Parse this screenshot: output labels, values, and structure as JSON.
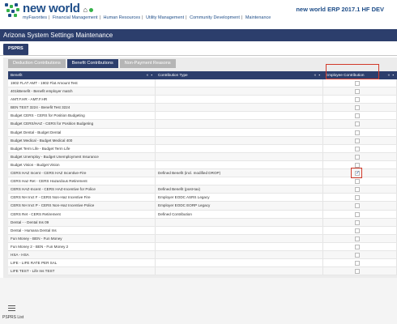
{
  "brand": {
    "name": "new world",
    "env": "new world ERP 2017.1 HF DEV"
  },
  "nav": [
    "myFavorites",
    "Financial Management",
    "Human Resources",
    "Utility Management",
    "Community Development",
    "Maintenance"
  ],
  "page_title": "Arizona System Settings Maintenance",
  "top_tab": "PSPRS",
  "subtabs": [
    "Deduction Contributions",
    "Benefit Contributions",
    "Non-Payment Reasons"
  ],
  "active_subtab": "Benefit Contributions",
  "grid": {
    "headers": [
      "Benefit",
      "Contribution Type",
      "Employee Contribution"
    ],
    "rows": [
      {
        "benefit": "1902 FLAT AMT - 1902 Flat Amount Test",
        "type": "",
        "checked": false
      },
      {
        "benefit": "401kBenefit - Benefit employer match",
        "type": "",
        "checked": false
      },
      {
        "benefit": "AMT.F.HR - AMT.F.HR",
        "type": "",
        "checked": false
      },
      {
        "benefit": "BEN TEST 3224 - Benefit Test 3224",
        "type": "",
        "checked": false
      },
      {
        "benefit": "Budget CERS - CERS for Position Budgeting",
        "type": "",
        "checked": false
      },
      {
        "benefit": "Budget CERS/HAZ - CERS for Position Budgeting",
        "type": "",
        "checked": false
      },
      {
        "benefit": "Budget Dental - Budget Dental",
        "type": "",
        "checked": false
      },
      {
        "benefit": "Budget Medical - Budget Medical 400",
        "type": "",
        "checked": false
      },
      {
        "benefit": "Budget Term Life - Budget Term Life",
        "type": "",
        "checked": false
      },
      {
        "benefit": "Budget Unemploy - Budget Unemployment Insurance",
        "type": "",
        "checked": false
      },
      {
        "benefit": "Budget Vision - Budget Vision",
        "type": "",
        "checked": false
      },
      {
        "benefit": "CERS HAZ Incent - CERS HAZ Incentive-Fire",
        "type": "Defined Benefit (incl. modified DROP)",
        "checked": true
      },
      {
        "benefit": "CERS Haz Ret - CERS Hazardous Retirement",
        "type": "",
        "checked": false
      },
      {
        "benefit": "CERS HAZ-Incent - CERS HAZ-Incentive for Police",
        "type": "Defined Benefit (post-tax)",
        "checked": false
      },
      {
        "benefit": "CERS NH Inct F - CERS Non-Haz Incentive Fire",
        "type": "Employer EODC ASRS Legacy",
        "checked": false
      },
      {
        "benefit": "CERS NH Inct P - CERS Non-Haz Incentive Police",
        "type": "Employer EODC EORP Legacy",
        "checked": false
      },
      {
        "benefit": "CERS Ret - CERS Retirement",
        "type": "Defined Contribution",
        "checked": false
      },
      {
        "benefit": "Dental - - Dental Ins 09",
        "type": "",
        "checked": false
      },
      {
        "benefit": "Dental - Humana Dental Ins",
        "type": "",
        "checked": false
      },
      {
        "benefit": "Fun Money - BEN - Fun Money",
        "type": "",
        "checked": false
      },
      {
        "benefit": "Fun Money 2 - BEN - Fun Money 2",
        "type": "",
        "checked": false
      },
      {
        "benefit": "HSA - HSA",
        "type": "",
        "checked": false
      },
      {
        "benefit": "LIFE - LIFE RATE PER SAL",
        "type": "",
        "checked": false
      },
      {
        "benefit": "LIFE TEST - Life Ins TEST",
        "type": "",
        "checked": false
      }
    ]
  },
  "footer": {
    "label": "PSPRS List"
  },
  "colors": {
    "primary": "#2c3e6c",
    "highlight": "#d23a2a",
    "brand": "#1f4e89"
  }
}
